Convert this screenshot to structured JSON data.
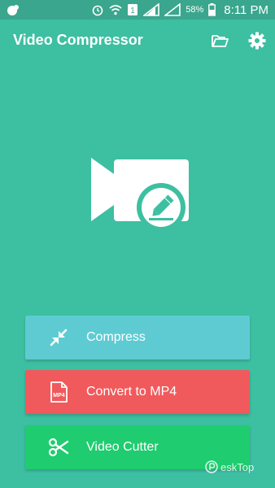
{
  "status_bar": {
    "battery_pct": "58%",
    "time": "8:11 PM",
    "sim_slot": "1"
  },
  "app": {
    "title": "Video Compressor",
    "background": "#3dbfa1"
  },
  "toolbar": {
    "folder_icon": "folder-open-icon",
    "settings_icon": "gear-icon"
  },
  "hero": {
    "icon": "video-camera-edit-icon"
  },
  "actions": [
    {
      "label": "Compress",
      "icon": "compress-arrows-icon",
      "color": "#5ecbd3"
    },
    {
      "label": "Convert to MP4",
      "icon": "mp4-file-icon",
      "color": "#f05a5c",
      "icon_text": "MP4"
    },
    {
      "label": "Video Cutter",
      "icon": "scissors-icon",
      "color": "#1fcc6f"
    }
  ],
  "watermark": {
    "text": "eskTop"
  }
}
